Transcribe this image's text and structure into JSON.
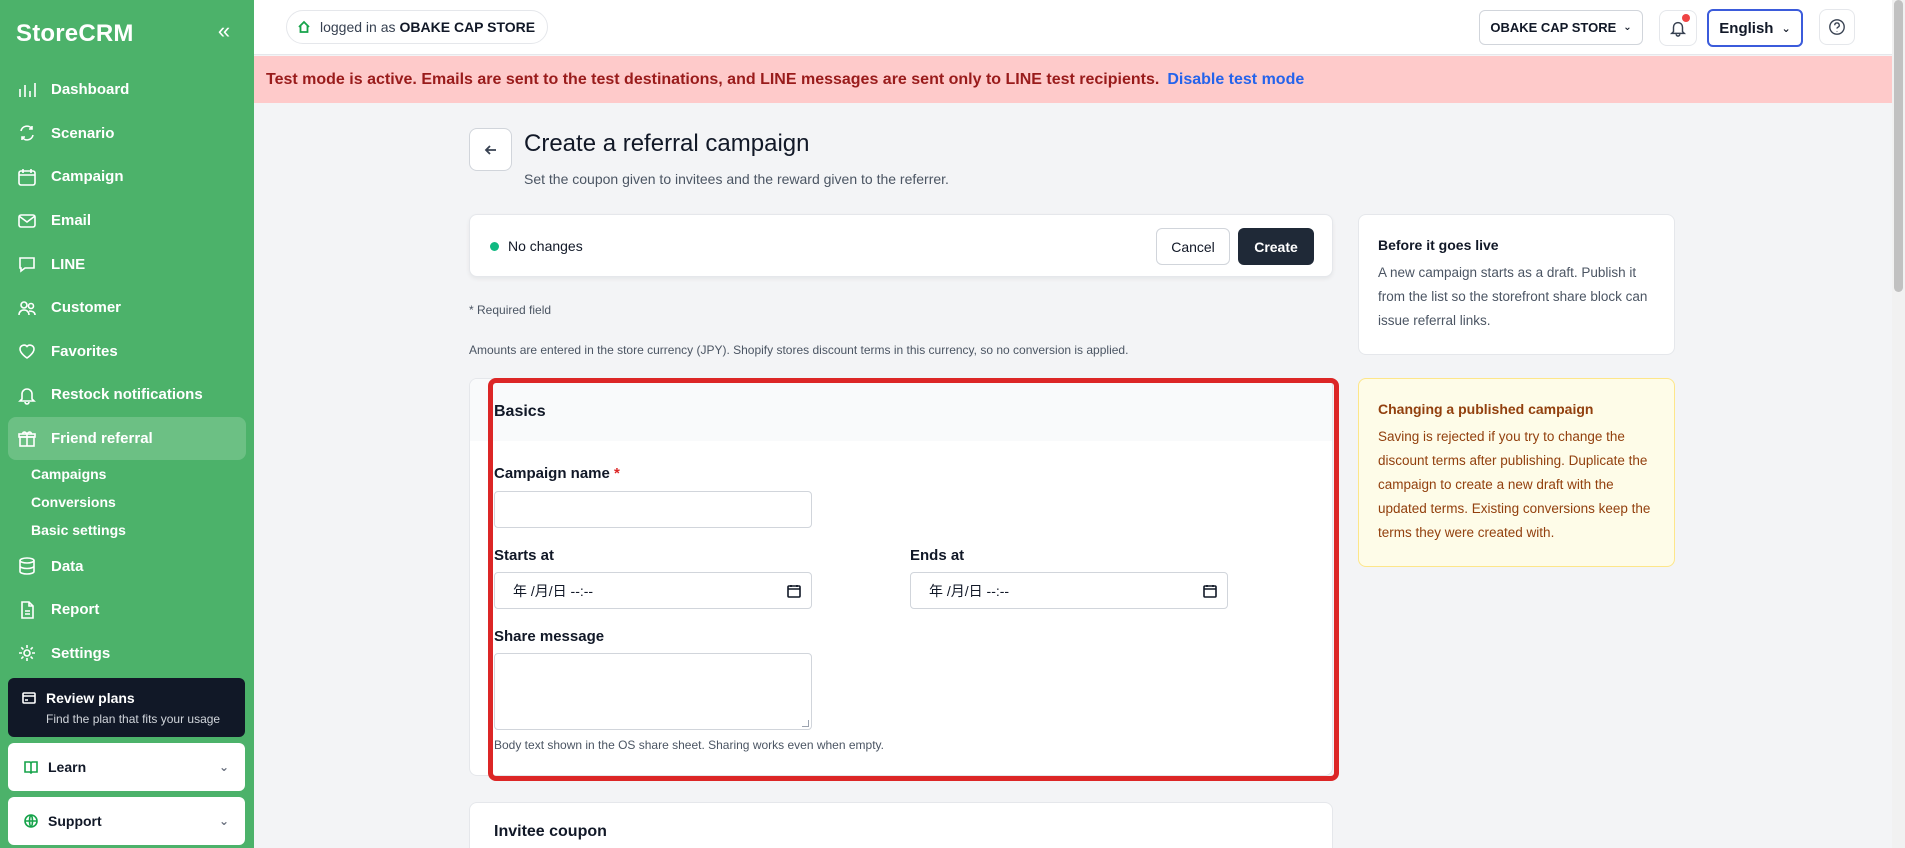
{
  "sidebar": {
    "brand": "StoreCRM",
    "items": [
      {
        "label": "Dashboard"
      },
      {
        "label": "Scenario"
      },
      {
        "label": "Campaign"
      },
      {
        "label": "Email"
      },
      {
        "label": "LINE"
      },
      {
        "label": "Customer"
      },
      {
        "label": "Favorites"
      },
      {
        "label": "Restock notifications"
      },
      {
        "label": "Friend referral"
      }
    ],
    "subitems": [
      {
        "label": "Campaigns"
      },
      {
        "label": "Conversions"
      },
      {
        "label": "Basic settings"
      }
    ],
    "items_after": [
      {
        "label": "Data"
      },
      {
        "label": "Report"
      },
      {
        "label": "Settings"
      }
    ],
    "review": {
      "title": "Review plans",
      "subtitle": "Find the plan that fits your usage"
    },
    "learn": "Learn",
    "support": "Support"
  },
  "topbar": {
    "logged_prefix": "logged in as",
    "store": "OBAKE CAP STORE",
    "store_select": "OBAKE CAP STORE",
    "language": "English"
  },
  "banner": {
    "text": "Test mode is active. Emails are sent to the test destinations, and LINE messages are sent only to LINE test recipients.",
    "link": "Disable test mode"
  },
  "page": {
    "title": "Create a referral campaign",
    "subtitle": "Set the coupon given to invitees and the reward given to the referrer."
  },
  "savebar": {
    "status": "No changes",
    "cancel": "Cancel",
    "create": "Create"
  },
  "notes": {
    "required": "* Required field",
    "amounts": "Amounts are entered in the store currency (JPY). Shopify stores discount terms in this currency, so no conversion is applied."
  },
  "basics": {
    "header": "Basics",
    "campaign_name_label": "Campaign name",
    "required_mark": "*",
    "campaign_name_value": "",
    "starts_label": "Starts at",
    "starts_value": "年 /月/日 --:--",
    "ends_label": "Ends at",
    "ends_value": "年 /月/日 --:--",
    "share_label": "Share message",
    "share_value": "",
    "share_hint": "Body text shown in the OS share sheet. Sharing works even when empty."
  },
  "invitee": {
    "header": "Invitee coupon"
  },
  "info": {
    "live_title": "Before it goes live",
    "live_body": "A new campaign starts as a draft. Publish it from the list so the storefront share block can issue referral links.",
    "published_title": "Changing a published campaign",
    "published_body": "Saving is rejected if you try to change the discount terms after publishing. Duplicate the campaign to create a new draft with the updated terms. Existing conversions keep the terms they were created with."
  },
  "colors": {
    "sidebar": "#4cb26a",
    "banner_bg": "#fecaca",
    "banner_text": "#991b1b",
    "highlight": "#dc2626",
    "primary_button": "#1f2937"
  }
}
